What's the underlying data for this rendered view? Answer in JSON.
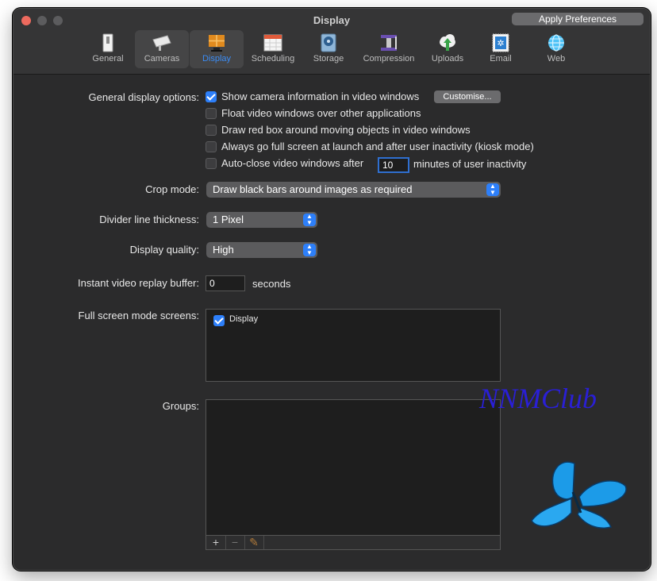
{
  "window": {
    "title": "Display",
    "apply_button": "Apply Preferences"
  },
  "tabs": [
    {
      "label": "General",
      "icon": "switch-icon"
    },
    {
      "label": "Cameras",
      "icon": "camera-icon"
    },
    {
      "label": "Display",
      "icon": "display-icon"
    },
    {
      "label": "Scheduling",
      "icon": "calendar-icon"
    },
    {
      "label": "Storage",
      "icon": "disk-icon"
    },
    {
      "label": "Compression",
      "icon": "vise-icon"
    },
    {
      "label": "Uploads",
      "icon": "cloud-upload-icon"
    },
    {
      "label": "Email",
      "icon": "stamp-icon"
    },
    {
      "label": "Web",
      "icon": "globe-icon"
    }
  ],
  "general_options": {
    "label": "General display options:",
    "options": [
      {
        "label": "Show camera information in video windows",
        "checked": true
      },
      {
        "label": "Float video windows over other applications",
        "checked": false
      },
      {
        "label": "Draw red box around moving objects in video windows",
        "checked": false
      },
      {
        "label": "Always go full screen at launch and after user inactivity (kiosk mode)",
        "checked": false
      },
      {
        "label": "Auto-close video windows after",
        "checked": false
      }
    ],
    "customise_button": "Customise...",
    "autoclose_value": "10",
    "autoclose_suffix": "minutes of user inactivity"
  },
  "crop_mode": {
    "label": "Crop mode:",
    "value": "Draw black bars around images as required"
  },
  "divider": {
    "label": "Divider line thickness:",
    "value": "1 Pixel"
  },
  "quality": {
    "label": "Display quality:",
    "value": "High"
  },
  "replay": {
    "label": "Instant video replay buffer:",
    "value": "0",
    "suffix": "seconds"
  },
  "fullscreen": {
    "label": "Full screen mode screens:",
    "items": [
      {
        "label": "Display",
        "checked": true
      }
    ]
  },
  "groups": {
    "label": "Groups:",
    "toolbar": {
      "add": "+",
      "remove": "−",
      "edit": "✎"
    }
  },
  "watermark": "NNMClub",
  "colors": {
    "accent": "#2d7ff9",
    "window_bg": "#2b2b2c",
    "close_button": "#ed6a5e",
    "watermark": "#2a1fd6",
    "butterfly": "#1c9be8"
  }
}
